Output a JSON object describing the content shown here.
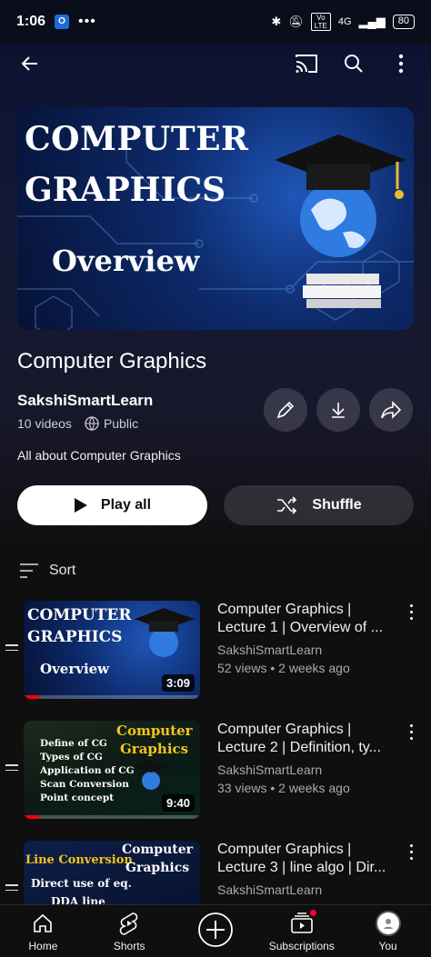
{
  "status_bar": {
    "time": "1:06",
    "outlook_letter": "O",
    "dots": "•••",
    "signal": "4G",
    "vo": "Vo LTE",
    "battery": "80"
  },
  "playlist": {
    "banner_line1": "COMPUTER",
    "banner_line2": "GRAPHICS",
    "banner_line3": "Overview",
    "title": "Computer Graphics",
    "channel": "SakshiSmartLearn",
    "video_count": "10 videos",
    "visibility": "Public",
    "description": "All about Computer Graphics",
    "play_all_label": "Play all",
    "shuffle_label": "Shuffle",
    "sort_label": "Sort"
  },
  "videos": [
    {
      "title_line1": "Computer Graphics |",
      "title_line2": "Lecture 1 | Overview of ...",
      "channel": "SakshiSmartLearn",
      "meta": "52 views • 2 weeks ago",
      "duration": "3:09",
      "thumb_lines": [
        "COMPUTER",
        "GRAPHICS",
        "Overview"
      ]
    },
    {
      "title_line1": "Computer Graphics |",
      "title_line2": "Lecture 2 | Definition, ty...",
      "channel": "SakshiSmartLearn",
      "meta": "33 views • 2 weeks ago",
      "duration": "9:40",
      "thumb_lines": [
        "Define of CG",
        "Types of CG",
        "Application of CG",
        "Scan Conversion",
        "Point concept",
        "Computer",
        "Graphics"
      ]
    },
    {
      "title_line1": "Computer Graphics |",
      "title_line2": "Lecture 3 | line algo | Dir...",
      "channel": "SakshiSmartLearn",
      "meta": "",
      "duration": "",
      "thumb_lines": [
        "Line Conversion",
        "Direct use of eq.",
        "DDA line",
        "Computer",
        "Graphics"
      ]
    }
  ],
  "bottom_nav": {
    "home": "Home",
    "shorts": "Shorts",
    "subscriptions": "Subscriptions",
    "you": "You"
  },
  "colors": {
    "accent_red": "#ff0000",
    "banner_blue": "#0d2a6b",
    "gold_text": "#f5c518"
  }
}
